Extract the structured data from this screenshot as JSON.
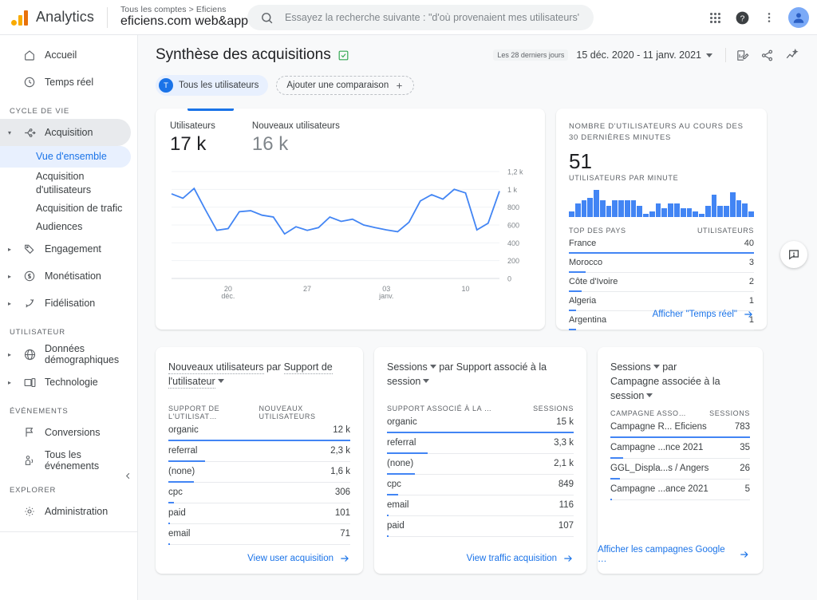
{
  "topbar": {
    "brand": "Analytics",
    "account_crumb": "Tous les comptes > Eficiens",
    "property": "eficiens.com web&app",
    "search_placeholder": "Essayez la recherche suivante : \"d'où provenaient mes utilisateurs\"",
    "search_value": "",
    "icons": {
      "apps": "apps-grid-icon",
      "help": "help-icon",
      "more": "more-vertical-icon",
      "avatar": "avatar-icon"
    }
  },
  "sidebar": {
    "top_items": [
      {
        "label": "Accueil",
        "icon": "home-icon"
      },
      {
        "label": "Temps réel",
        "icon": "clock-icon"
      }
    ],
    "sections": [
      {
        "title": "CYCLE DE VIE",
        "items": [
          {
            "label": "Acquisition",
            "icon": "acquisition-icon",
            "expanded": true,
            "active": true,
            "children": [
              {
                "label": "Vue d'ensemble",
                "selected": true
              },
              {
                "label": "Acquisition d'utilisateurs",
                "selected": false
              },
              {
                "label": "Acquisition de trafic",
                "selected": false
              },
              {
                "label": "Audiences",
                "selected": false
              }
            ]
          },
          {
            "label": "Engagement",
            "icon": "tag-icon",
            "expanded": false
          },
          {
            "label": "Monétisation",
            "icon": "dollar-icon",
            "expanded": false
          },
          {
            "label": "Fidélisation",
            "icon": "retention-icon",
            "expanded": false
          }
        ]
      },
      {
        "title": "UTILISATEUR",
        "items": [
          {
            "label": "Données démographiques",
            "icon": "globe-icon",
            "expanded": false
          },
          {
            "label": "Technologie",
            "icon": "device-icon",
            "expanded": false
          }
        ]
      },
      {
        "title": "ÉVÉNEMENTS",
        "items": [
          {
            "label": "Conversions",
            "icon": "flag-icon"
          },
          {
            "label": "Tous les événements",
            "icon": "events-icon"
          }
        ]
      },
      {
        "title": "EXPLORER",
        "items": [
          {
            "label": "Administration",
            "icon": "gear-icon"
          }
        ]
      }
    ],
    "collapse_icon": "chevron-left-icon"
  },
  "page": {
    "title": "Synthèse des acquisitions",
    "title_badge_icon": "insights-check-icon",
    "date_chip": "Les 28 derniers jours",
    "date_range": "15 déc. 2020 - 11 janv. 2021",
    "header_icons": [
      "edit-comparison-icon",
      "share-icon",
      "insights-icon"
    ],
    "audience_pill": {
      "initial": "T",
      "label": "Tous les utilisateurs"
    },
    "comparison_pill": {
      "label": "Ajouter une comparaison",
      "icon": "plus-icon"
    }
  },
  "cards": {
    "users_card": {
      "metrics": [
        {
          "label": "Utilisateurs",
          "value": "17 k"
        },
        {
          "label": "Nouveaux utilisateurs",
          "value": "16 k"
        }
      ]
    },
    "realtime": {
      "headline": "NOMBRE D'UTILISATEURS AU COURS DES 30 DERNIÈRES MINUTES",
      "big_value": "51",
      "sub_label": "UTILISATEURS PAR MINUTE",
      "table_head": {
        "left": "TOP DES PAYS",
        "right": "UTILISATEURS"
      },
      "rows": [
        {
          "name": "France",
          "value": "40",
          "pct": 100
        },
        {
          "name": "Morocco",
          "value": "3",
          "pct": 9
        },
        {
          "name": "Côte d'Ivoire",
          "value": "2",
          "pct": 7
        },
        {
          "name": "Algeria",
          "value": "1",
          "pct": 4
        },
        {
          "name": "Argentina",
          "value": "1",
          "pct": 4
        }
      ],
      "link": "Afficher \"Temps réel\"",
      "link_icon": "arrow-right-icon"
    },
    "user_medium": {
      "title_prefix": "Nouveaux utilisateurs",
      "title_mid": "par",
      "title_dim": "Support de l'utilisateur",
      "head": {
        "left": "SUPPORT DE L'UTILISAT…",
        "right": "NOUVEAUX UTILISATEURS"
      },
      "rows": [
        {
          "name": "organic",
          "value": "12 k",
          "pct": 100
        },
        {
          "name": "referral",
          "value": "2,3 k",
          "pct": 20
        },
        {
          "name": "(none)",
          "value": "1,6 k",
          "pct": 14
        },
        {
          "name": "cpc",
          "value": "306",
          "pct": 3
        },
        {
          "name": "paid",
          "value": "101",
          "pct": 1
        },
        {
          "name": "email",
          "value": "71",
          "pct": 1
        }
      ],
      "link": "View user acquisition",
      "link_icon": "arrow-right-icon"
    },
    "session_medium": {
      "title_metric": "Sessions",
      "title_mid": "par",
      "title_dim": "Support associé à la session",
      "head": {
        "left": "SUPPORT ASSOCIÉ À LA …",
        "right": "SESSIONS"
      },
      "rows": [
        {
          "name": "organic",
          "value": "15 k",
          "pct": 100
        },
        {
          "name": "referral",
          "value": "3,3 k",
          "pct": 22
        },
        {
          "name": "(none)",
          "value": "2,1 k",
          "pct": 15
        },
        {
          "name": "cpc",
          "value": "849",
          "pct": 6
        },
        {
          "name": "email",
          "value": "116",
          "pct": 1
        },
        {
          "name": "paid",
          "value": "107",
          "pct": 1
        }
      ],
      "link": "View traffic acquisition",
      "link_icon": "arrow-right-icon"
    },
    "campaign": {
      "title_metric": "Sessions",
      "title_mid": "par",
      "title_dim": "Campagne associée à la session",
      "head": {
        "left": "CAMPAGNE ASSO…",
        "right": "SESSIONS"
      },
      "rows": [
        {
          "name": "Campagne R... Eficiens",
          "value": "783",
          "pct": 100
        },
        {
          "name": "Campagne ...nce 2021",
          "value": "35",
          "pct": 9
        },
        {
          "name": "GGL_Displa...s / Angers",
          "value": "26",
          "pct": 7
        },
        {
          "name": "Campagne ...ance 2021",
          "value": "5",
          "pct": 1
        }
      ],
      "link": "Afficher les campagnes Google …",
      "link_icon": "arrow-right-icon"
    },
    "feedback_fab": "feedback-icon"
  },
  "chart_data": [
    {
      "type": "line",
      "title": "Utilisateurs",
      "xlabel": "",
      "ylabel": "",
      "ylim": [
        0,
        1200
      ],
      "yticks": [
        0,
        200,
        400,
        600,
        800,
        1000,
        1200
      ],
      "ytick_labels": [
        "0",
        "200",
        "400",
        "600",
        "800",
        "1 k",
        "1,2 k"
      ],
      "grid": true,
      "legend": "none",
      "xtick_labels": [
        "20 déc.",
        "27",
        "03 janv.",
        "10"
      ],
      "xtick_index": [
        5,
        12,
        19,
        26
      ],
      "series": [
        {
          "name": "Utilisateurs",
          "color": "#4285f4",
          "values": [
            950,
            900,
            1010,
            770,
            540,
            560,
            750,
            760,
            710,
            690,
            500,
            580,
            540,
            570,
            690,
            640,
            665,
            600,
            570,
            545,
            525,
            630,
            870,
            940,
            890,
            1000,
            960,
            545,
            620,
            980
          ]
        }
      ]
    },
    {
      "type": "bar",
      "title": "Utilisateurs par minute (30 dernières minutes)",
      "ylim": [
        0,
        10
      ],
      "grid": false,
      "categories": [
        "1",
        "2",
        "3",
        "4",
        "5",
        "6",
        "7",
        "8",
        "9",
        "10",
        "11",
        "12",
        "13",
        "14",
        "15",
        "16",
        "17",
        "18",
        "19",
        "20",
        "21",
        "22",
        "23",
        "24",
        "25",
        "26",
        "27",
        "28",
        "29",
        "30"
      ],
      "values": [
        2,
        5,
        6,
        7,
        10,
        6,
        4,
        6,
        6,
        6,
        6,
        4,
        1,
        2,
        5,
        3,
        5,
        5,
        3,
        3,
        2,
        1,
        4,
        8,
        4,
        4,
        9,
        6,
        5,
        2
      ]
    }
  ],
  "colors": {
    "accent_blue": "#1a73e8",
    "chart_blue": "#4285f4",
    "brand_orange": "#f9ab00",
    "text_primary": "#202124",
    "text_secondary": "#5f6368",
    "page_bg": "#f8f9fa"
  }
}
